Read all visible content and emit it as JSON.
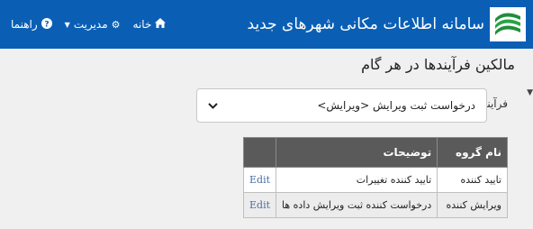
{
  "navbar": {
    "brand_title": "سامانه اطلاعات مکانی شهرهای جدید",
    "home_label": "خانه",
    "management_label": "مدیریت",
    "help_label": "راهنما"
  },
  "page": {
    "title": "مالکین فرآیندها در هر گام",
    "process_label": "فرآیند:",
    "process_value": "درخواست ثبت ویرایش <ویرایش>"
  },
  "table": {
    "headers": {
      "group": "نام گروه",
      "description": "توضیحات",
      "edit": ""
    },
    "rows": [
      {
        "group": "تایید کننده",
        "description": "تایید کننده تغییرات",
        "edit": "Edit"
      },
      {
        "group": "ویرایش کننده",
        "description": "درخواست کننده ثبت ویرایش داده ها",
        "edit": "Edit"
      }
    ]
  },
  "icons": [
    "logo-icon",
    "home-icon",
    "gear-icon",
    "help-icon",
    "chevron-down-icon"
  ],
  "colors": {
    "navbar": "#0a5fb5",
    "table_header": "#5a5a5a",
    "link": "#4a6fa5"
  }
}
